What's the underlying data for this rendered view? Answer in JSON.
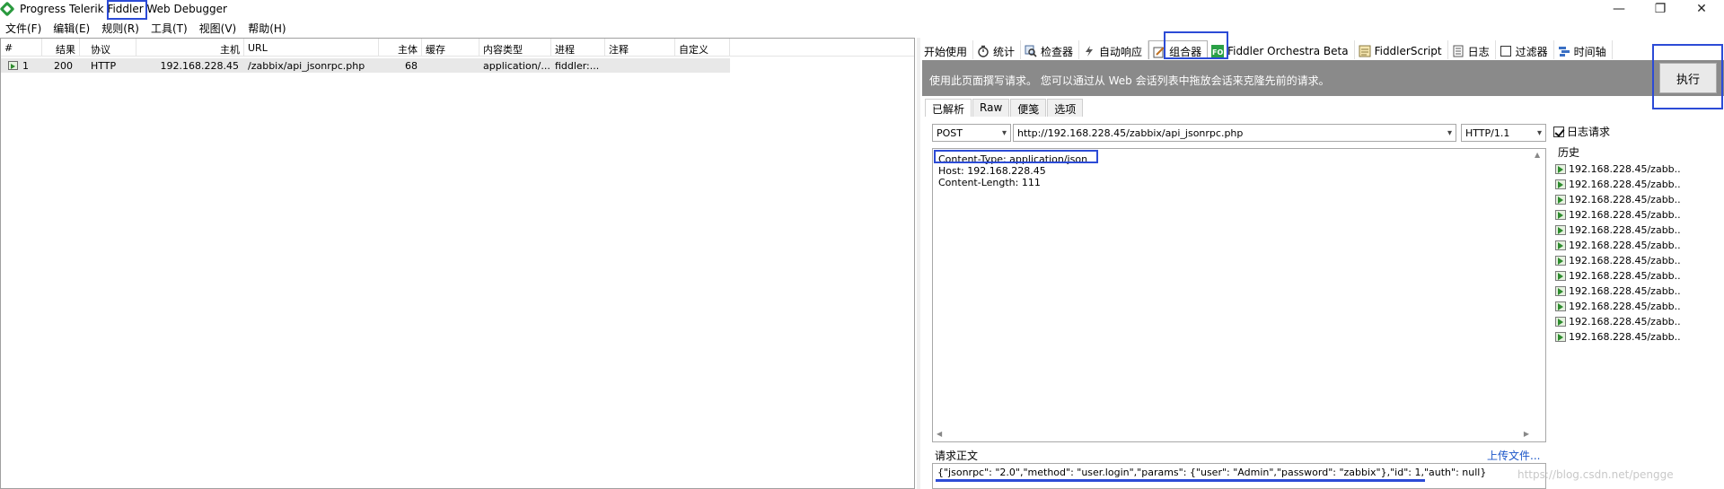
{
  "window": {
    "title": "Progress Telerik Fiddler Web Debugger",
    "controls": {
      "minimize": "—",
      "restore": "❐",
      "close": "✕"
    }
  },
  "menu": [
    "文件(F)",
    "编辑(E)",
    "规则(R)",
    "工具(T)",
    "视图(V)",
    "帮助(H)"
  ],
  "sessions": {
    "columns": [
      "#",
      "结果",
      "协议",
      "主机",
      "URL",
      "主体",
      "缓存",
      "内容类型",
      "进程",
      "注释",
      "自定义"
    ],
    "rows": [
      {
        "id": "1",
        "result": "200",
        "protocol": "HTTP",
        "host": "192.168.228.45",
        "url": "/zabbix/api_jsonrpc.php",
        "body": "68",
        "caching": "",
        "content_type": "application/...",
        "process": "fiddler:...",
        "comments": "",
        "custom": ""
      }
    ]
  },
  "inspector_tabs": [
    {
      "label": "开始使用",
      "icon": ""
    },
    {
      "label": "统计",
      "icon": "stopwatch-icon"
    },
    {
      "label": "检查器",
      "icon": "inspect-icon"
    },
    {
      "label": "自动响应",
      "icon": "lightning-icon"
    },
    {
      "label": "组合器",
      "icon": "composer-icon"
    },
    {
      "label": "Fiddler Orchestra Beta",
      "icon": "fo-icon"
    },
    {
      "label": "FiddlerScript",
      "icon": "script-icon"
    },
    {
      "label": "日志",
      "icon": "log-icon"
    },
    {
      "label": "过滤器",
      "icon": "filter-icon"
    },
    {
      "label": "时间轴",
      "icon": "timeline-icon"
    }
  ],
  "composer": {
    "banner": "使用此页面撰写请求。 您可以通过从 Web 会话列表中拖放会话来克隆先前的请求。",
    "execute_label": "执行",
    "subtabs": [
      "已解析",
      "Raw",
      "便笺",
      "选项"
    ],
    "method": "POST",
    "url": "http://192.168.228.45/zabbix/api_jsonrpc.php",
    "http_version": "HTTP/1.1",
    "headers": [
      "Content-Type: application/json",
      "Host: 192.168.228.45",
      "Content-Length: 111"
    ],
    "body_label": "请求正文",
    "upload_label": "上传文件...",
    "body": "{\"jsonrpc\": \"2.0\",\"method\": \"user.login\",\"params\": {\"user\": \"Admin\",\"password\": \"zabbix\"},\"id\": 1,\"auth\": null}",
    "log_requests_label": "日志请求",
    "log_requests_checked": true,
    "history_label": "历史",
    "history": [
      "192.168.228.45/zabb...",
      "192.168.228.45/zabb...",
      "192.168.228.45/zabb...",
      "192.168.228.45/zabb...",
      "192.168.228.45/zabb...",
      "192.168.228.45/zabb...",
      "192.168.228.45/zabb...",
      "192.168.228.45/zabb...",
      "192.168.228.45/zabb...",
      "192.168.228.45/zabb...",
      "192.168.228.45/zabb...",
      "192.168.228.45/zabb..."
    ]
  },
  "watermark": "https://blog.csdn.net/pengge",
  "colors": {
    "highlight": "#2c4bd6",
    "banner": "#8a8a8a",
    "link": "#1a55c8"
  }
}
